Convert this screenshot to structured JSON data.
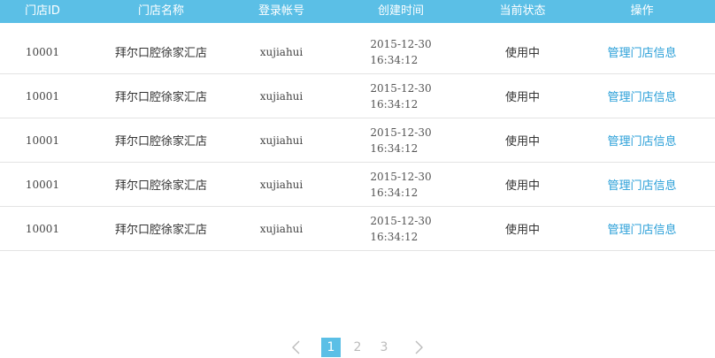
{
  "table": {
    "headers": [
      "门店ID",
      "门店名称",
      "登录帐号",
      "创建时间",
      "当前状态",
      "操作"
    ],
    "rows": [
      {
        "id": "10001",
        "name": "拜尔口腔徐家汇店",
        "account": "xujiahui",
        "date": "2015-12-30",
        "time": "16:34:12",
        "status": "使用中",
        "action": "管理门店信息"
      },
      {
        "id": "10001",
        "name": "拜尔口腔徐家汇店",
        "account": "xujiahui",
        "date": "2015-12-30",
        "time": "16:34:12",
        "status": "使用中",
        "action": "管理门店信息"
      },
      {
        "id": "10001",
        "name": "拜尔口腔徐家汇店",
        "account": "xujiahui",
        "date": "2015-12-30",
        "time": "16:34:12",
        "status": "使用中",
        "action": "管理门店信息"
      },
      {
        "id": "10001",
        "name": "拜尔口腔徐家汇店",
        "account": "xujiahui",
        "date": "2015-12-30",
        "time": "16:34:12",
        "status": "使用中",
        "action": "管理门店信息"
      },
      {
        "id": "10001",
        "name": "拜尔口腔徐家汇店",
        "account": "xujiahui",
        "date": "2015-12-30",
        "time": "16:34:12",
        "status": "使用中",
        "action": "管理门店信息"
      }
    ]
  },
  "pagination": {
    "pages": [
      "1",
      "2",
      "3"
    ],
    "current": "1",
    "prev_icon": "chevron-left-icon",
    "next_icon": "chevron-right-icon"
  },
  "colors": {
    "header_bg": "#5bbfe6",
    "link": "#2a9fd8",
    "active_page_bg": "#5bbfe6"
  }
}
